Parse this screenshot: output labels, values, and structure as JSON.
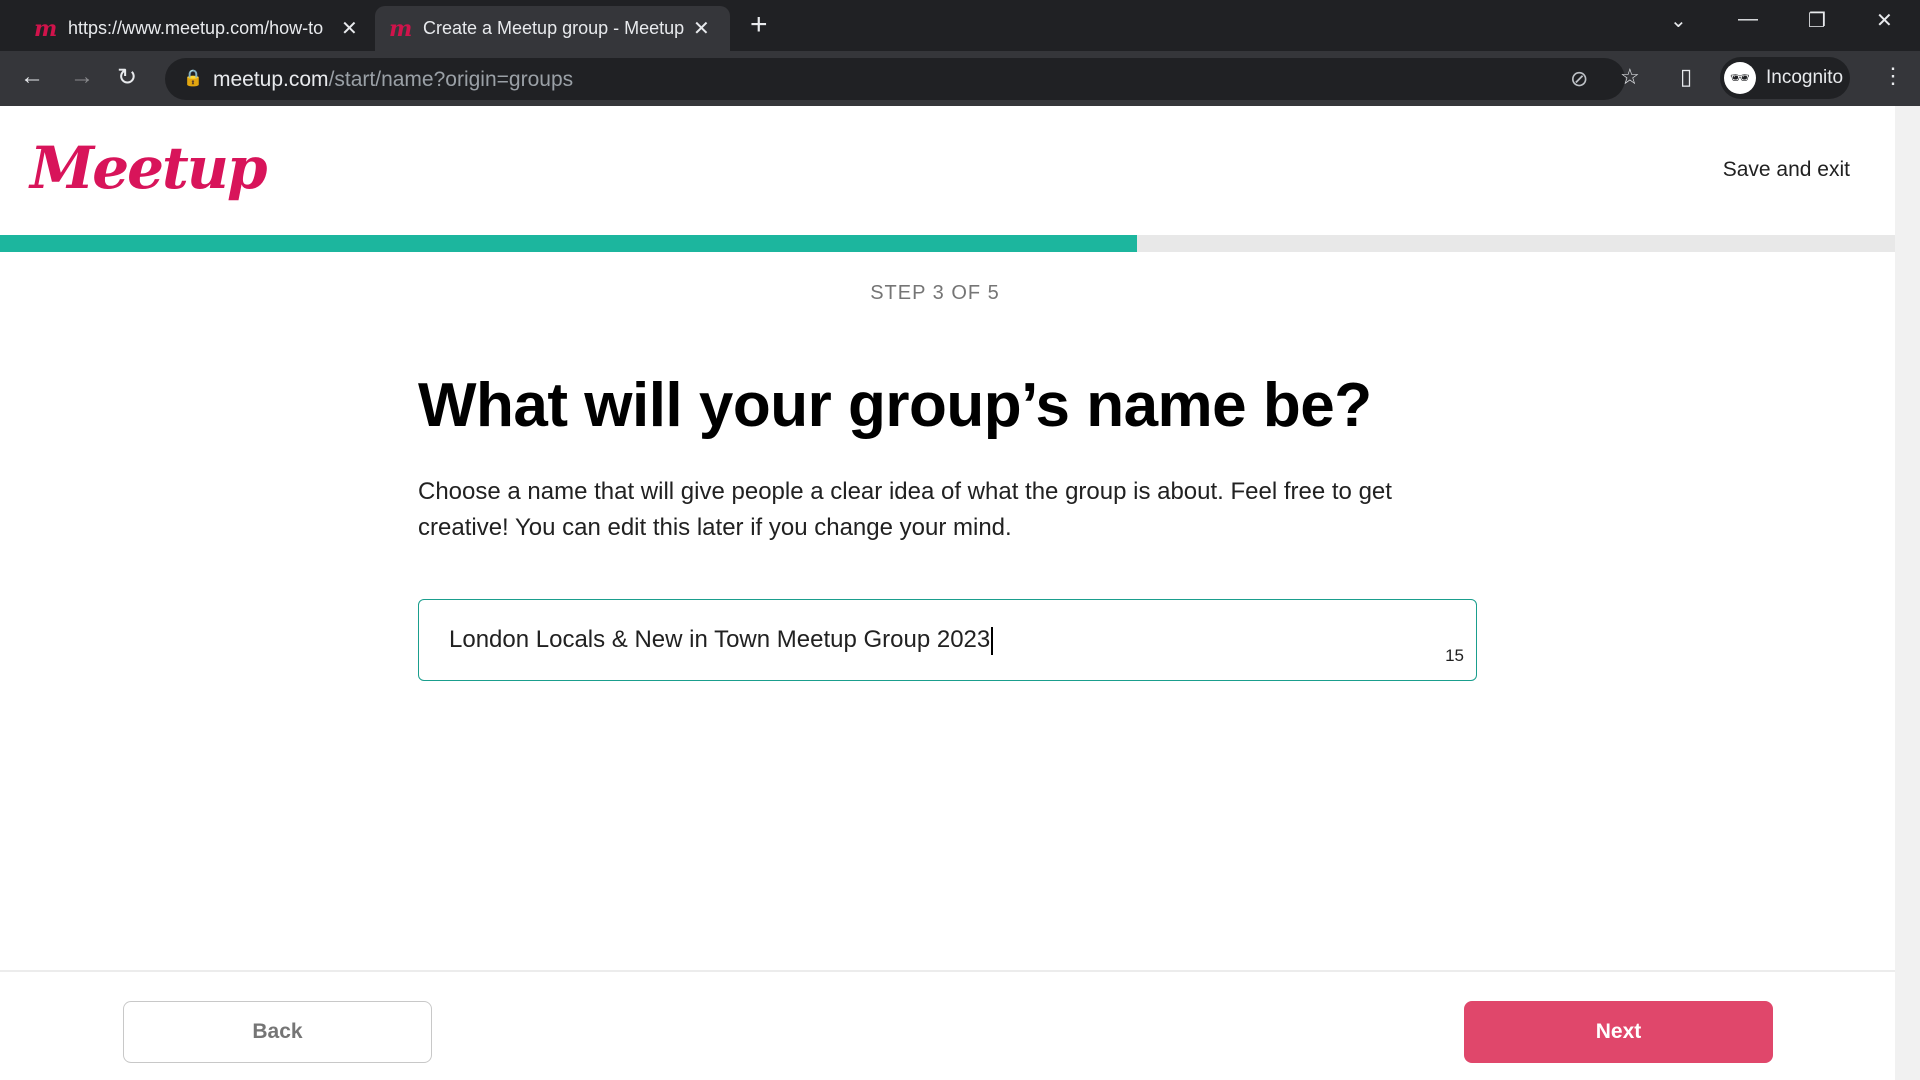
{
  "browser": {
    "tabs": [
      {
        "title": "https://www.meetup.com/how-to",
        "active": false
      },
      {
        "title": "Create a Meetup group - Meetup",
        "active": true
      }
    ],
    "url_domain": "meetup.com",
    "url_path": "/start/name?origin=groups",
    "profile_label": "Incognito"
  },
  "header": {
    "logo": "Meetup",
    "save_exit": "Save and exit"
  },
  "progress": {
    "percent": 60,
    "color": "#1cb69e",
    "step_label": "STEP 3 OF 5"
  },
  "main": {
    "title": "What will your group’s name be?",
    "description": "Choose a name that will give people a clear idea of what the group is about. Feel free to get creative! You can edit this later if you change your mind.",
    "input_value": "London Locals & New in Town Meetup Group 2023",
    "char_count": "15"
  },
  "footer": {
    "back": "Back",
    "next": "Next",
    "next_color": "#e0476b"
  }
}
